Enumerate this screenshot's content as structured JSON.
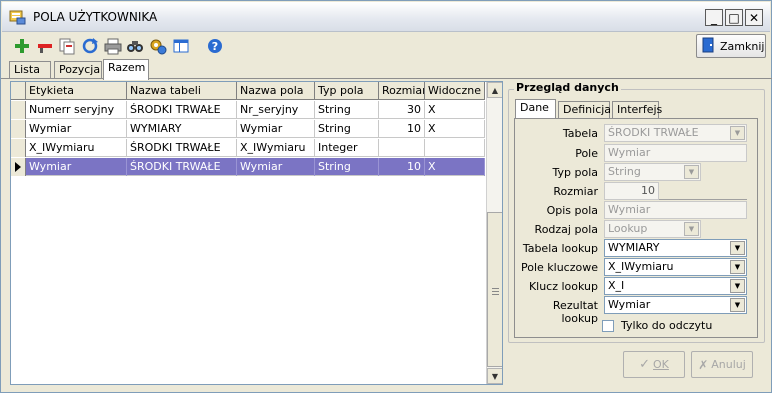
{
  "window": {
    "title": "POLA UŻYTKOWNIKA",
    "minimize_glyph": "_",
    "maximize_glyph": "□",
    "close_glyph": "✕"
  },
  "toolbar": {
    "icons": [
      "add-icon",
      "remove-icon",
      "copy-icon",
      "refresh-icon",
      "print-icon",
      "find-icon",
      "settings-icon",
      "view-icon",
      "help-icon"
    ],
    "close_label": "Zamknij",
    "accent": "#2a6bd1"
  },
  "tabs": [
    {
      "label": "Lista"
    },
    {
      "label": "Pozycja"
    },
    {
      "label": "Razem"
    }
  ],
  "grid": {
    "columns": [
      "Etykieta",
      "Nazwa tabeli",
      "Nazwa pola",
      "Typ pola",
      "Rozmiar",
      "Widoczne"
    ],
    "rows": [
      {
        "etykieta": "Numerr seryjny",
        "tabela": "ŚRODKI TRWAŁE",
        "pole": "Nr_seryjny",
        "typ": "String",
        "rozmiar": "30",
        "widoczne": "X"
      },
      {
        "etykieta": "Wymiar",
        "tabela": "WYMIARY",
        "pole": "Wymiar",
        "typ": "String",
        "rozmiar": "10",
        "widoczne": "X"
      },
      {
        "etykieta": "X_IWymiaru",
        "tabela": "ŚRODKI TRWAŁE",
        "pole": "X_IWymiaru",
        "typ": "Integer",
        "rozmiar": "",
        "widoczne": ""
      },
      {
        "etykieta": "Wymiar",
        "tabela": "ŚRODKI TRWAŁE",
        "pole": "Wymiar",
        "typ": "String",
        "rozmiar": "10",
        "widoczne": "X"
      }
    ],
    "selected_color": "#7b74c4"
  },
  "panel": {
    "title": "Przegląd danych",
    "tabs": [
      {
        "label": "Dane"
      },
      {
        "label": "Definicja"
      },
      {
        "label": "Interfejs"
      }
    ],
    "fields": {
      "tabela": {
        "label": "Tabela",
        "value": "ŚRODKI TRWAŁE"
      },
      "pole": {
        "label": "Pole",
        "value": "Wymiar"
      },
      "typ_pola": {
        "label": "Typ pola",
        "value": "String"
      },
      "rozmiar": {
        "label": "Rozmiar",
        "value": "10"
      },
      "opis_pola": {
        "label": "Opis pola",
        "value": "Wymiar"
      },
      "rodzaj_pola": {
        "label": "Rodzaj pola",
        "value": "Lookup"
      },
      "tabela_lookup": {
        "label": "Tabela lookup",
        "value": "WYMIARY"
      },
      "pole_kluczowe": {
        "label": "Pole kluczowe",
        "value": "X_IWymiaru"
      },
      "klucz_lookup": {
        "label": "Klucz lookup",
        "value": "X_I"
      },
      "rezultat_lookup": {
        "label": "Rezultat lookup",
        "value": "Wymiar"
      }
    },
    "readonly_label": "Tylko do odczytu",
    "ok_label": "OK",
    "cancel_label": "Anuluj"
  }
}
